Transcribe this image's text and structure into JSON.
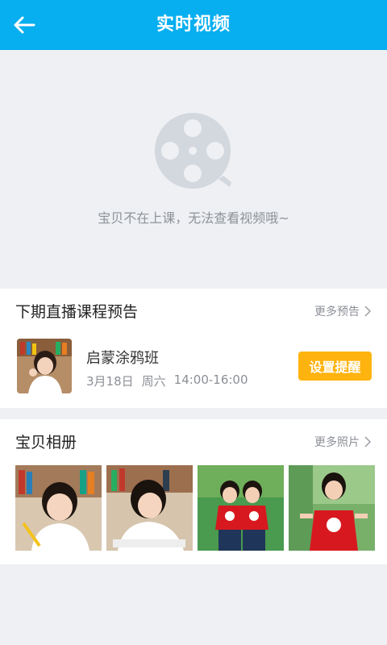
{
  "header": {
    "title": "实时视频",
    "back_icon": "back-arrow-icon"
  },
  "video": {
    "icon": "film-reel-icon",
    "empty_message": "宝贝不在上课，无法查看视频哦~"
  },
  "upcoming": {
    "title": "下期直播课程预告",
    "more_label": "更多预告",
    "course": {
      "name": "启蒙涂鸦班",
      "date": "3月18日",
      "weekday": "周六",
      "time": "14:00-16:00",
      "remind_label": "设置提醒"
    }
  },
  "album": {
    "title": "宝贝相册",
    "more_label": "更多照片"
  },
  "colors": {
    "primary": "#07aef0",
    "accent": "#ffb30f",
    "background": "#eef0f3"
  }
}
